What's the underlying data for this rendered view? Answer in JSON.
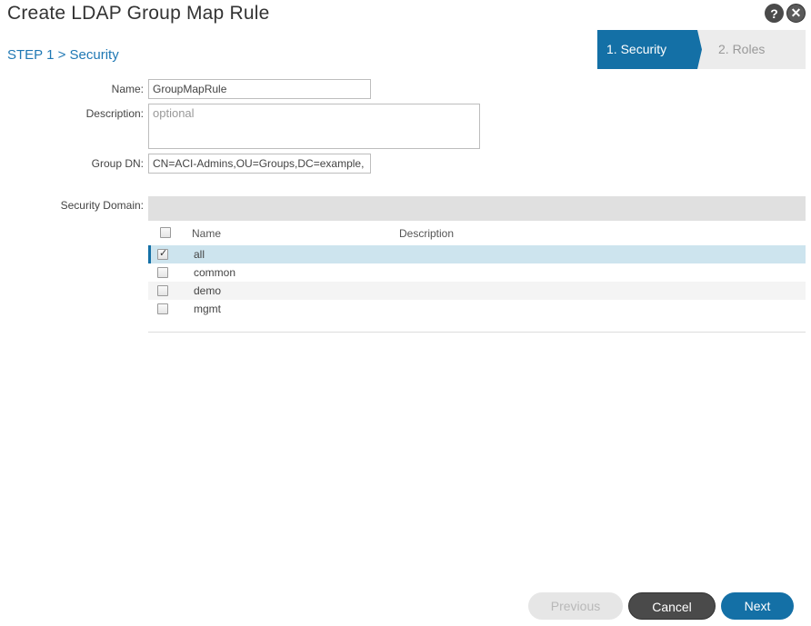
{
  "dialog": {
    "title": "Create LDAP Group Map Rule",
    "help_label": "?",
    "close_label": "✕"
  },
  "step_label": "STEP 1 > Security",
  "wizard": {
    "steps": [
      {
        "label": "1. Security",
        "active": true
      },
      {
        "label": "2. Roles",
        "active": false
      }
    ]
  },
  "form": {
    "name_label": "Name:",
    "name_value": "GroupMapRule",
    "description_label": "Description:",
    "description_placeholder": "optional",
    "group_dn_label": "Group DN:",
    "group_dn_value": "CN=ACI-Admins,OU=Groups,DC=example,"
  },
  "security_domain": {
    "label": "Security Domain:",
    "columns": [
      "Name",
      "Description"
    ],
    "rows": [
      {
        "name": "all",
        "checked": true
      },
      {
        "name": "common",
        "checked": false
      },
      {
        "name": "demo",
        "checked": false
      },
      {
        "name": "mgmt",
        "checked": false
      }
    ]
  },
  "buttons": {
    "previous": "Previous",
    "cancel": "Cancel",
    "next": "Next"
  },
  "colors": {
    "accent": "#1470a6",
    "selected_row": "#cde4ee",
    "cancel_bg": "#4a4a4a"
  }
}
